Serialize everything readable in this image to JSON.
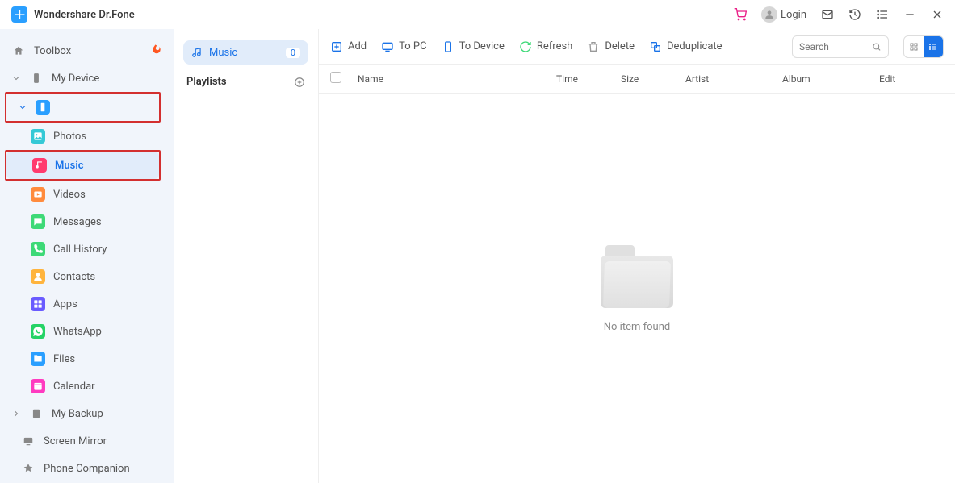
{
  "app": {
    "title": "Wondershare Dr.Fone"
  },
  "titlebar": {
    "login": "Login"
  },
  "sidebar": {
    "toolbox": "Toolbox",
    "myDevice": "My Device",
    "myBackup": "My Backup",
    "screenMirror": "Screen Mirror",
    "phoneCompanion": "Phone Companion",
    "items": {
      "photos": "Photos",
      "music": "Music",
      "videos": "Videos",
      "messages": "Messages",
      "callHistory": "Call History",
      "contacts": "Contacts",
      "apps": "Apps",
      "whatsapp": "WhatsApp",
      "files": "Files",
      "calendar": "Calendar"
    }
  },
  "playlists": {
    "music": "Music",
    "count": "0",
    "header": "Playlists"
  },
  "toolbar": {
    "add": "Add",
    "toPc": "To PC",
    "toDevice": "To Device",
    "refresh": "Refresh",
    "delete": "Delete",
    "deduplicate": "Deduplicate",
    "searchPlaceholder": "Search"
  },
  "table": {
    "name": "Name",
    "time": "Time",
    "size": "Size",
    "artist": "Artist",
    "album": "Album",
    "edit": "Edit"
  },
  "empty": {
    "text": "No item found"
  }
}
